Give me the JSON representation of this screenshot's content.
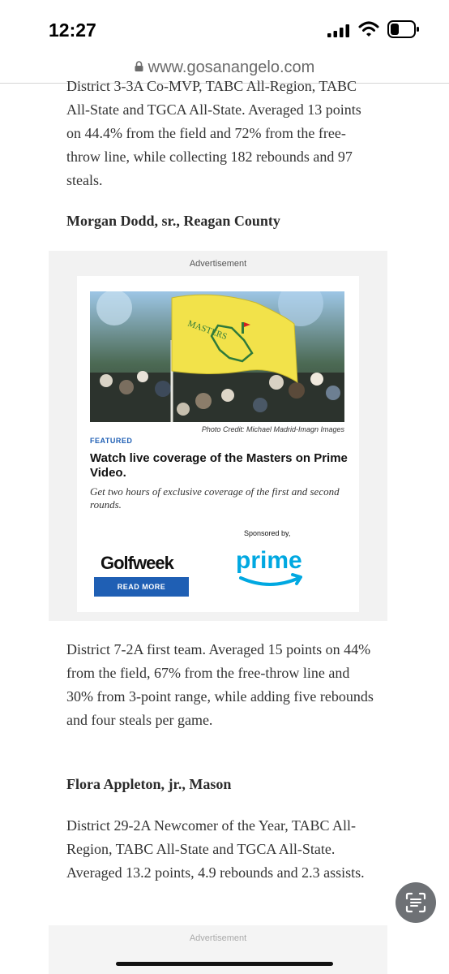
{
  "status_bar": {
    "time": "12:27"
  },
  "browser": {
    "url": "www.gosanangelo.com"
  },
  "article": {
    "paragraph_1": "District 3-3A Co-MVP, TABC All-Region, TABC All-State and TGCA All-State. Averaged 13 points on 44.4% from the field and 72% from the free-throw line, while collecting 182 rebounds and 97 steals.",
    "heading_1": "Morgan Dodd, sr., Reagan County",
    "paragraph_2": "District 7-2A first team. Averaged 15 points on 44% from the field, 67% from the free-throw line and 30% from 3-point range, while adding five rebounds and four steals per game.",
    "heading_2": "Flora Appleton, jr., Mason",
    "paragraph_3": "District 29-2A Newcomer of the Year, TABC All-Region, TABC All-State and TGCA All-State. Averaged 13.2 points, 4.9 rebounds and 2.3 assists."
  },
  "ad": {
    "label": "Advertisement",
    "photo_credit": "Photo Credit: Michael Madrid-Imagn Images",
    "flag_text": "MASTERS",
    "featured": "FEATURED",
    "headline": "Watch live coverage of the Masters on Prime Video.",
    "description": "Get two hours of exclusive coverage of the first and second rounds.",
    "brand": "Golfweek",
    "sponsored_by": "Sponsored by,",
    "sponsor": "prime",
    "button": "READ MORE"
  },
  "ad_bottom": {
    "label": "Advertisement"
  },
  "colors": {
    "accent_blue": "#1f5fb4",
    "prime_blue": "#00a8e1",
    "flag_yellow": "#f2e24a"
  }
}
